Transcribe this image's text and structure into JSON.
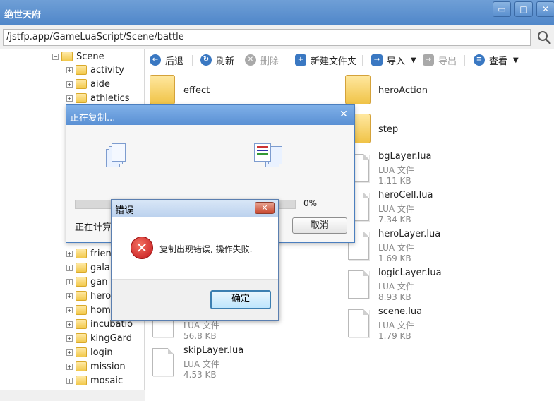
{
  "window": {
    "title": "绝世天府",
    "min_glyph": "▭",
    "max_glyph": "□",
    "close_glyph": "✕"
  },
  "address": {
    "path": "/jstfp.app/GameLuaScript/Scene/battle"
  },
  "tree": {
    "root": "Scene",
    "items_top": [
      "activity",
      "aide",
      "athletics"
    ],
    "items_bottom": [
      "frien",
      "gala",
      "gan",
      "hero",
      "hom",
      "incubatio",
      "kingGard",
      "login",
      "mission",
      "mosaic"
    ]
  },
  "toolbar": {
    "back": "后退",
    "refresh": "刷新",
    "delete": "删除",
    "new_folder": "新建文件夹",
    "import": "导入",
    "export": "导出",
    "view": "查看"
  },
  "files": {
    "folders": [
      "effect",
      "heroAction",
      "step"
    ],
    "docs": [
      {
        "name": "bgLayer.lua",
        "type": "LUA 文件",
        "size": "1.11 KB"
      },
      {
        "name": "heroCell.lua",
        "type": "LUA 文件",
        "size": "7.34 KB"
      },
      {
        "name": "heroLayer.lua",
        "type": "LUA 文件",
        "size": "1.69 KB"
      },
      {
        "name": "logicLayer.lua",
        "type": "LUA 文件",
        "size": "8.93 KB"
      },
      {
        "name": "scene.lua",
        "type": "LUA 文件",
        "size": "1.79 KB"
      }
    ],
    "left_docs": [
      {
        "name": "",
        "type": "LUA 文件",
        "size": "56.8 KB"
      },
      {
        "name": "skipLayer.lua",
        "type": "LUA 文件",
        "size": "4.53 KB"
      }
    ]
  },
  "copy_dialog": {
    "title": "正在复制...",
    "percent": "0%",
    "progress": 0,
    "status": "正在计算",
    "cancel": "取消"
  },
  "error_dialog": {
    "title": "错误",
    "message": "复制出现错误, 操作失败.",
    "ok": "确定"
  }
}
